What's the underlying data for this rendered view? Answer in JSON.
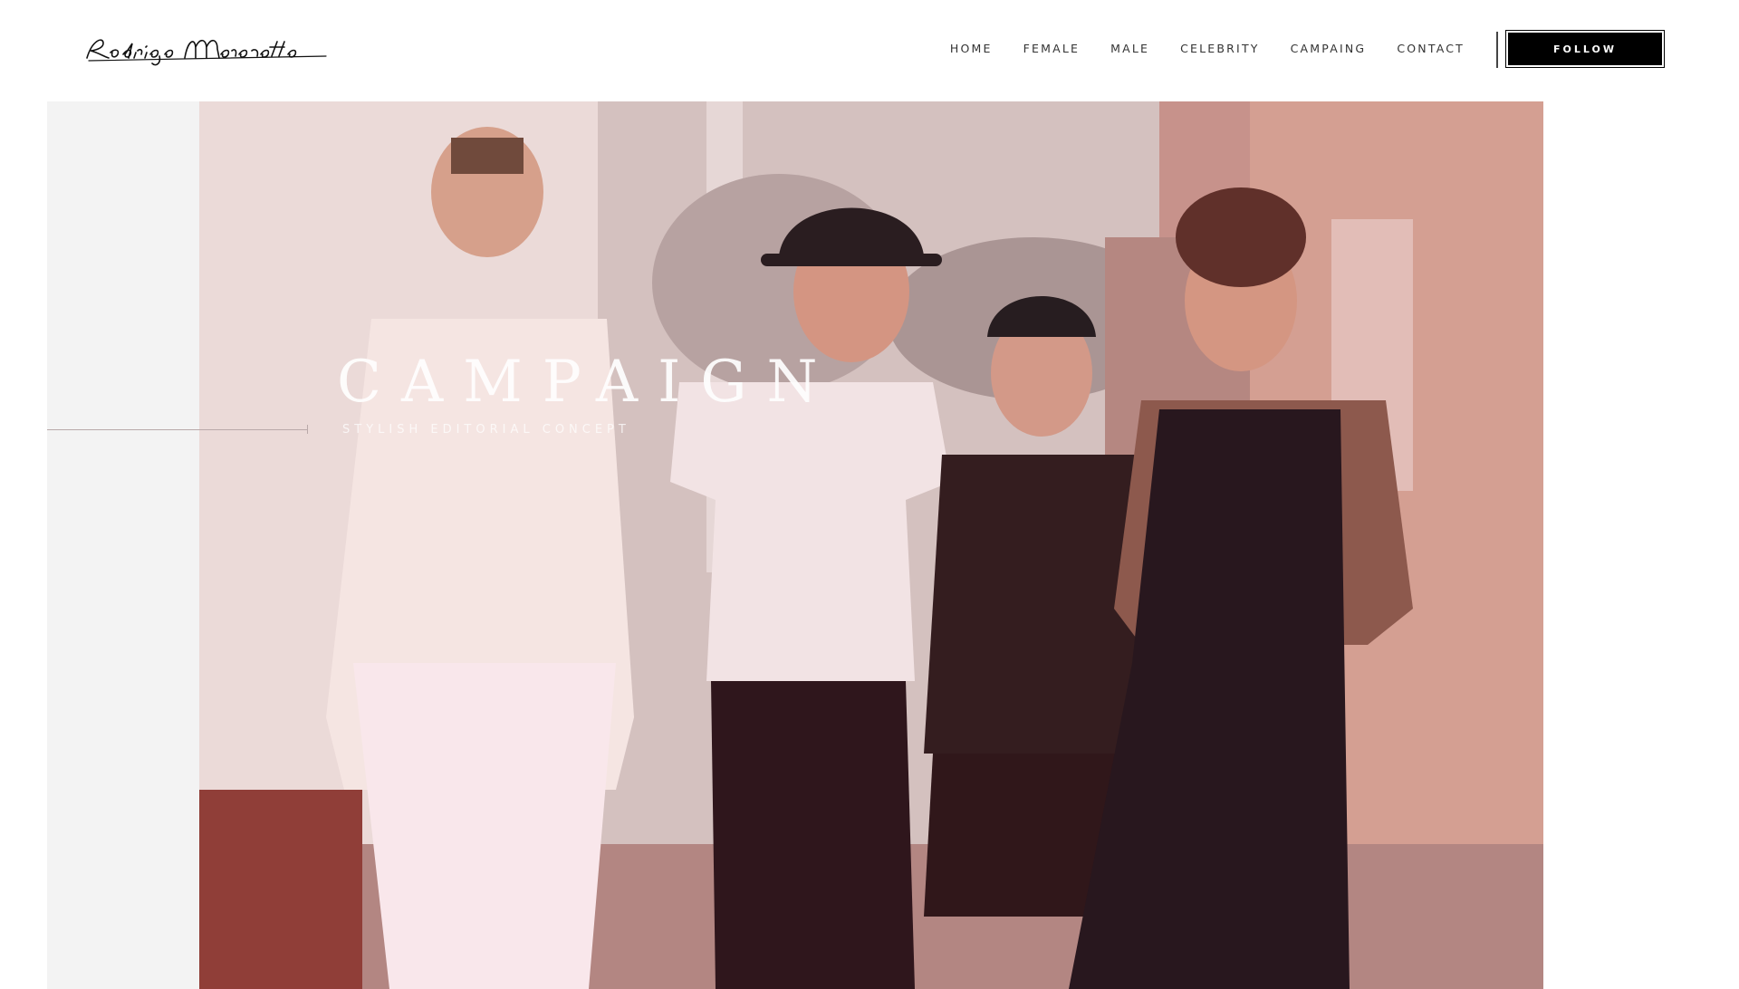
{
  "header": {
    "logo_alt": "Rodrigo Marconatto",
    "nav": [
      {
        "label": "HOME"
      },
      {
        "label": "FEMALE"
      },
      {
        "label": "MALE"
      },
      {
        "label": "CELEBRITY"
      },
      {
        "label": "CAMPAING"
      },
      {
        "label": "CONTACT"
      }
    ],
    "follow_label": "FOLLOW"
  },
  "hero": {
    "title": "CAMPAIGN",
    "subtitle": "STYLISH EDITORIAL CONCEPT",
    "image_icon": "photo-image"
  },
  "colors": {
    "accent": "#000000",
    "background": "#ffffff",
    "panel": "#f3f3f3"
  }
}
